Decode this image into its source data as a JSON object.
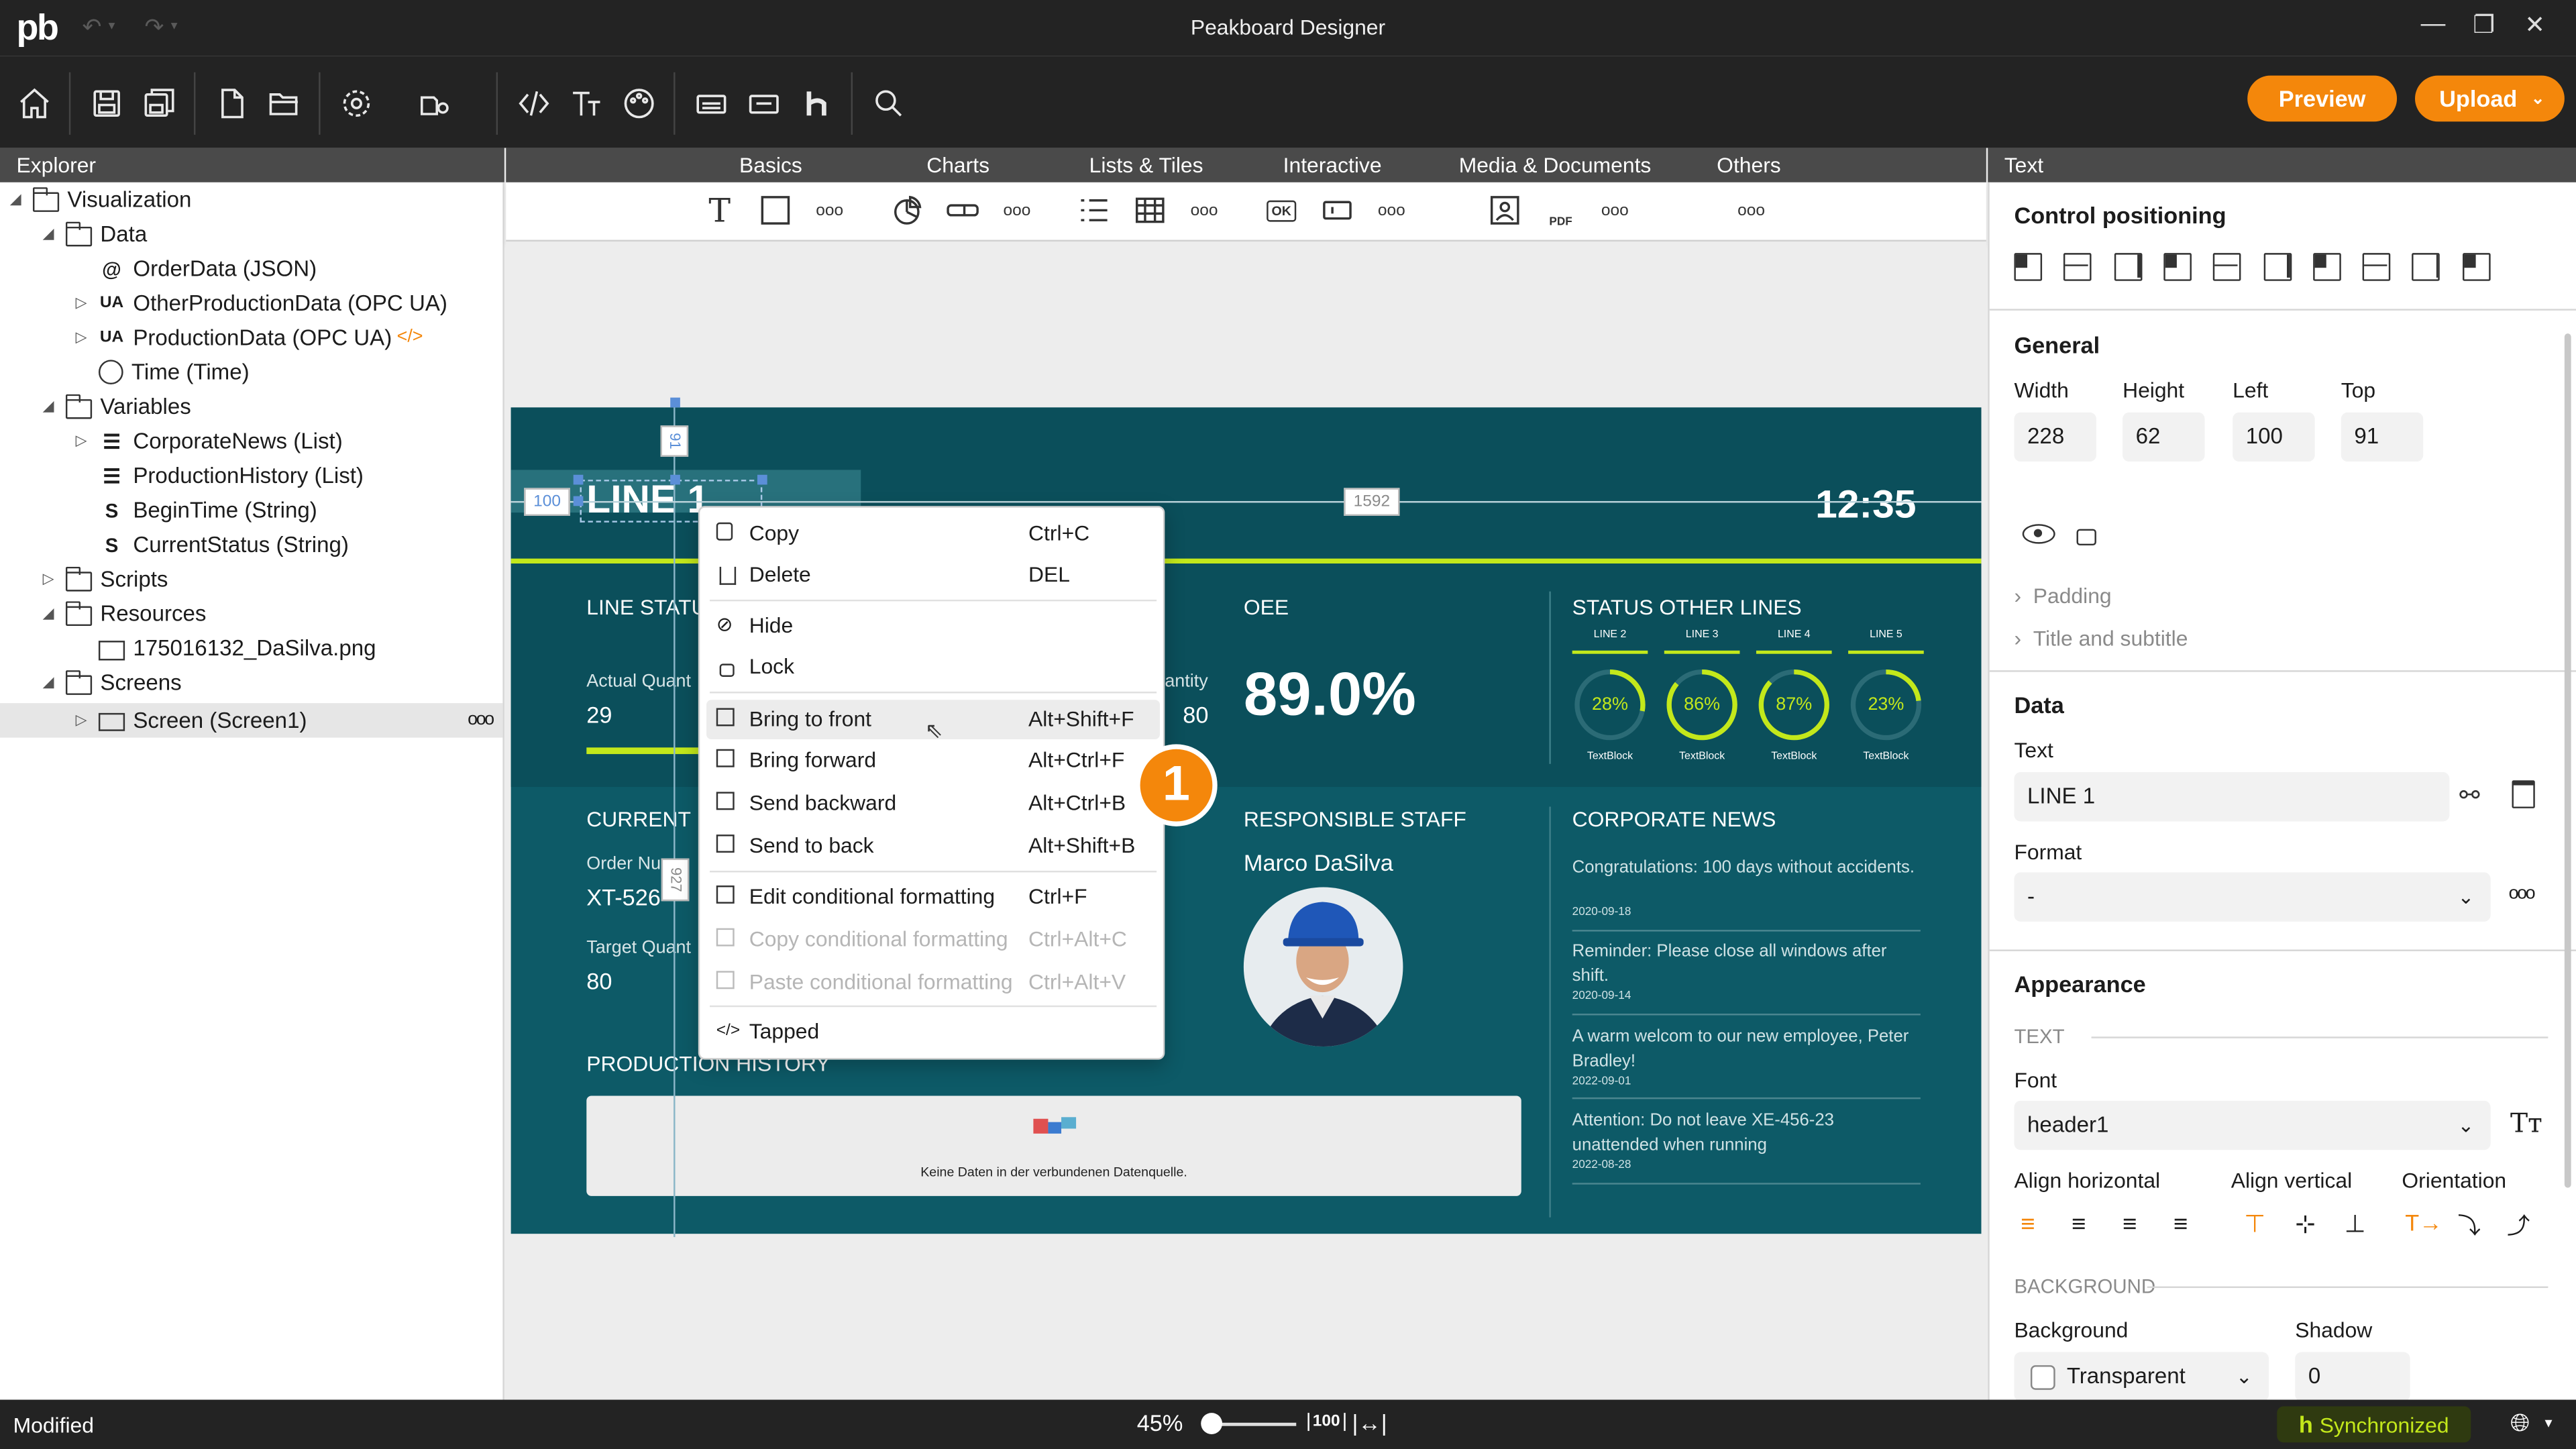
{
  "app": {
    "title": "Peakboard Designer",
    "logo": "pb"
  },
  "toolbar": {
    "preview_label": "Preview",
    "upload_label": "Upload"
  },
  "explorer": {
    "header": "Explorer",
    "items": [
      {
        "label": "Visualization"
      },
      {
        "label": "Data"
      },
      {
        "label": "OrderData (JSON)"
      },
      {
        "label": "OtherProductionData (OPC UA)"
      },
      {
        "label": "ProductionData (OPC UA)"
      },
      {
        "label": "Time (Time)"
      },
      {
        "label": "Variables"
      },
      {
        "label": "CorporateNews (List)"
      },
      {
        "label": "ProductionHistory (List)"
      },
      {
        "label": "BeginTime (String)"
      },
      {
        "label": "CurrentStatus (String)"
      },
      {
        "label": "Scripts"
      },
      {
        "label": "Resources"
      },
      {
        "label": "175016132_DaSilva.png"
      },
      {
        "label": "Screens"
      },
      {
        "label": "Screen (Screen1)"
      }
    ],
    "more": "ooo",
    "ua_badge": "UA",
    "code_badge": "</>"
  },
  "tabs": [
    "Basics",
    "Charts",
    "Lists & Tiles",
    "Interactive",
    "Media & Documents",
    "Others"
  ],
  "palette": {
    "more": "ooo",
    "ok_label": "OK",
    "pdf_label": "PDF"
  },
  "canvas": {
    "selection": {
      "left_value": "100",
      "top_value": "91",
      "right_value": "1592",
      "bottom_value": "927"
    },
    "dashboard": {
      "line_title": "LINE 1",
      "clock": "12:35",
      "line_status_label": "LINE STATU",
      "actual_qty_label": "Actual Quant",
      "actual_qty_value": "29",
      "target_qty_label_right": "antity",
      "target_qty_right_value": "80",
      "oee_label": "OEE",
      "oee_value": "89.0%",
      "status_other_label": "STATUS OTHER LINES",
      "gauges": [
        {
          "line": "LINE 2",
          "value": "28%",
          "pct": 28,
          "caption": "TextBlock"
        },
        {
          "line": "LINE 3",
          "value": "86%",
          "pct": 86,
          "caption": "TextBlock"
        },
        {
          "line": "LINE 4",
          "value": "87%",
          "pct": 87,
          "caption": "TextBlock"
        },
        {
          "line": "LINE 5",
          "value": "23%",
          "pct": 23,
          "caption": "TextBlock"
        }
      ],
      "current_label": "CURRENT",
      "order_label": "Order Nu",
      "order_value": "XT-526",
      "target_label": "Target Quant",
      "target_value": "80",
      "staff_label": "RESPONSIBLE STAFF",
      "staff_name": "Marco DaSilva",
      "news_label": "CORPORATE NEWS",
      "news": [
        {
          "text": "Congratulations: 100 days without accidents.",
          "date": "2020-09-18"
        },
        {
          "text": "Reminder: Please close all windows after shift.",
          "date": "2020-09-14"
        },
        {
          "text": "A warm welcom to our new employee, Peter Bradley!",
          "date": "2022-09-01"
        },
        {
          "text": "Attention: Do not leave XE-456-23 unattended when running",
          "date": "2022-08-28"
        }
      ],
      "history_label": "PRODUCTION HISTORY",
      "no_data": "Keine Daten in der verbundenen Datenquelle."
    }
  },
  "context_menu": {
    "badge": "1",
    "items": [
      {
        "label": "Copy",
        "key": "Ctrl+C"
      },
      {
        "label": "Delete",
        "key": "DEL"
      },
      {
        "label": "Hide",
        "key": ""
      },
      {
        "label": "Lock",
        "key": ""
      },
      {
        "label": "Bring to front",
        "key": "Alt+Shift+F"
      },
      {
        "label": "Bring forward",
        "key": "Alt+Ctrl+F"
      },
      {
        "label": "Send backward",
        "key": "Alt+Ctrl+B"
      },
      {
        "label": "Send to back",
        "key": "Alt+Shift+B"
      },
      {
        "label": "Edit conditional formatting",
        "key": "Ctrl+F"
      },
      {
        "label": "Copy conditional formatting",
        "key": "Ctrl+Alt+C"
      },
      {
        "label": "Paste conditional formatting",
        "key": "Ctrl+Alt+V"
      },
      {
        "label": "Tapped",
        "key": ""
      }
    ]
  },
  "properties": {
    "header": "Text",
    "control_positioning": "Control positioning",
    "general": "General",
    "width_label": "Width",
    "height_label": "Height",
    "left_label": "Left",
    "top_label": "Top",
    "width": "228",
    "height": "62",
    "left": "100",
    "top": "91",
    "padding": "Padding",
    "title_subtitle": "Title and subtitle",
    "data": "Data",
    "text_label": "Text",
    "text_value": "LINE 1",
    "format_label": "Format",
    "format_value": "-",
    "more": "ooo",
    "appearance": "Appearance",
    "text_section": "TEXT",
    "font_label": "Font",
    "font_value": "header1",
    "align_h": "Align horizontal",
    "align_v": "Align vertical",
    "orientation": "Orientation",
    "background_section": "BACKGROUND",
    "background_label": "Background",
    "shadow_label": "Shadow",
    "background_value": "Transparent",
    "shadow_value": "0"
  },
  "status": {
    "modified": "Modified",
    "zoom": "45%",
    "zoom_fit": "100",
    "sync": "Synchronized"
  },
  "colors": {
    "accent": "#f4870b",
    "lime": "#c3e81b",
    "dashboard": "#0d5a67"
  }
}
